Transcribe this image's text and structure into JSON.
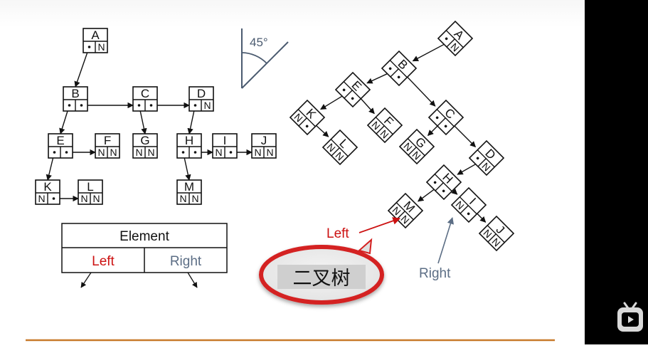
{
  "colors": {
    "line": "#111111",
    "left": "#cc1111",
    "right": "#5c6e85",
    "angle": "#4b5b70",
    "oval": "#d42020",
    "footer_rule": "#c87a2a"
  },
  "labels": {
    "angle": "45°",
    "left_arrow": "Left",
    "right_arrow": "Right",
    "binary_tree": "二叉树",
    "legend_element": "Element",
    "legend_left": "Left",
    "legend_right": "Right"
  },
  "nodes": [
    {
      "name": "A",
      "left": "",
      "right": "N"
    },
    {
      "name": "B",
      "left": "",
      "right": ""
    },
    {
      "name": "C",
      "left": "",
      "right": ""
    },
    {
      "name": "D",
      "left": "",
      "right": "N"
    },
    {
      "name": "E",
      "left": "",
      "right": ""
    },
    {
      "name": "F",
      "left": "N",
      "right": "N"
    },
    {
      "name": "G",
      "left": "N",
      "right": "N"
    },
    {
      "name": "H",
      "left": "",
      "right": ""
    },
    {
      "name": "I",
      "left": "N",
      "right": ""
    },
    {
      "name": "J",
      "left": "N",
      "right": "N"
    },
    {
      "name": "K",
      "left": "N",
      "right": ""
    },
    {
      "name": "L",
      "left": "N",
      "right": "N"
    },
    {
      "name": "M",
      "left": "N",
      "right": "N"
    }
  ],
  "tree_edges": [
    {
      "from": "A",
      "to": "B"
    },
    {
      "from": "B",
      "to": "E"
    },
    {
      "from": "B",
      "to": "C"
    },
    {
      "from": "C",
      "to": "G"
    },
    {
      "from": "C",
      "to": "D"
    },
    {
      "from": "D",
      "to": "H"
    },
    {
      "from": "E",
      "to": "K"
    },
    {
      "from": "E",
      "to": "F"
    },
    {
      "from": "H",
      "to": "M"
    },
    {
      "from": "H",
      "to": "I"
    },
    {
      "from": "I",
      "to": "J"
    },
    {
      "from": "K",
      "to": "L"
    }
  ],
  "binary_edges": [
    {
      "from": "A",
      "to": "B"
    },
    {
      "from": "B",
      "to": "E"
    },
    {
      "from": "B",
      "to": "C"
    },
    {
      "from": "E",
      "to": "K"
    },
    {
      "from": "E",
      "to": "F"
    },
    {
      "from": "K",
      "to": "L"
    },
    {
      "from": "C",
      "to": "G"
    },
    {
      "from": "C",
      "to": "D"
    },
    {
      "from": "D",
      "to": "H"
    },
    {
      "from": "H",
      "to": "M"
    },
    {
      "from": "H",
      "to": "I"
    },
    {
      "from": "I",
      "to": "J"
    }
  ]
}
